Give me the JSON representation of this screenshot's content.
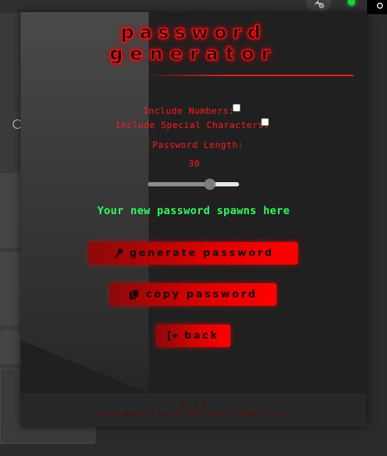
{
  "popup": {
    "title_line1": "Password",
    "title_line2": "Generator",
    "options": {
      "include_numbers_label": "Include Numbers:",
      "include_numbers_checked": false,
      "include_special_label": "Include Special Characters:",
      "include_special_checked": false,
      "length_label": "Password Length:",
      "length_value": "30",
      "length_fraction": 0.68
    },
    "output_text": "Your new password spawns here",
    "buttons": {
      "generate": "Generate Password",
      "copy": "Copy Password",
      "back": "Back"
    },
    "footer": {
      "version": "v1.3.3",
      "credit": "Development & Design 2022-2023 © S3R43o3 & AI"
    }
  },
  "colors": {
    "accent_red": "#ff1a1a",
    "output_green": "#2aff5a",
    "popup_bg": "#202020"
  },
  "icons": {
    "generate": "key-icon",
    "copy": "copy-icon",
    "back": "sign-out-icon",
    "extension": "puzzle-plus-icon",
    "status": "green-dot-icon"
  }
}
